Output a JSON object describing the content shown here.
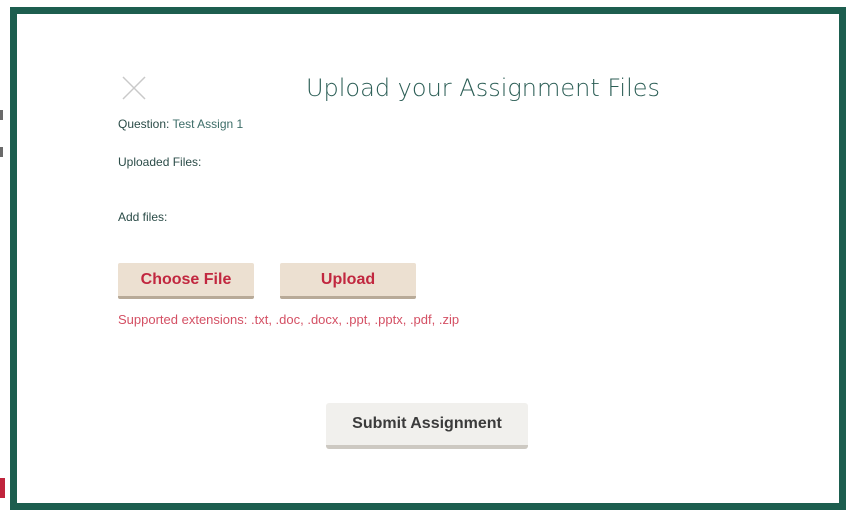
{
  "modal": {
    "title": "Upload your Assignment Files",
    "close_icon": "close-icon",
    "question_label": "Question:",
    "question_value": "Test Assign 1",
    "uploaded_files_label": "Uploaded Files:",
    "add_files_label": "Add files:",
    "choose_file_label": "Choose File",
    "upload_label": "Upload",
    "supported_extensions": "Supported extensions: .txt, .doc, .docx, .ppt, .pptx, .pdf, .zip",
    "submit_label": "Submit Assignment"
  },
  "colors": {
    "border": "#1d5e4f",
    "title": "#2c5e56",
    "accent": "#c1273f",
    "button_bg": "#ece0d1",
    "extension_text": "#d45064"
  }
}
